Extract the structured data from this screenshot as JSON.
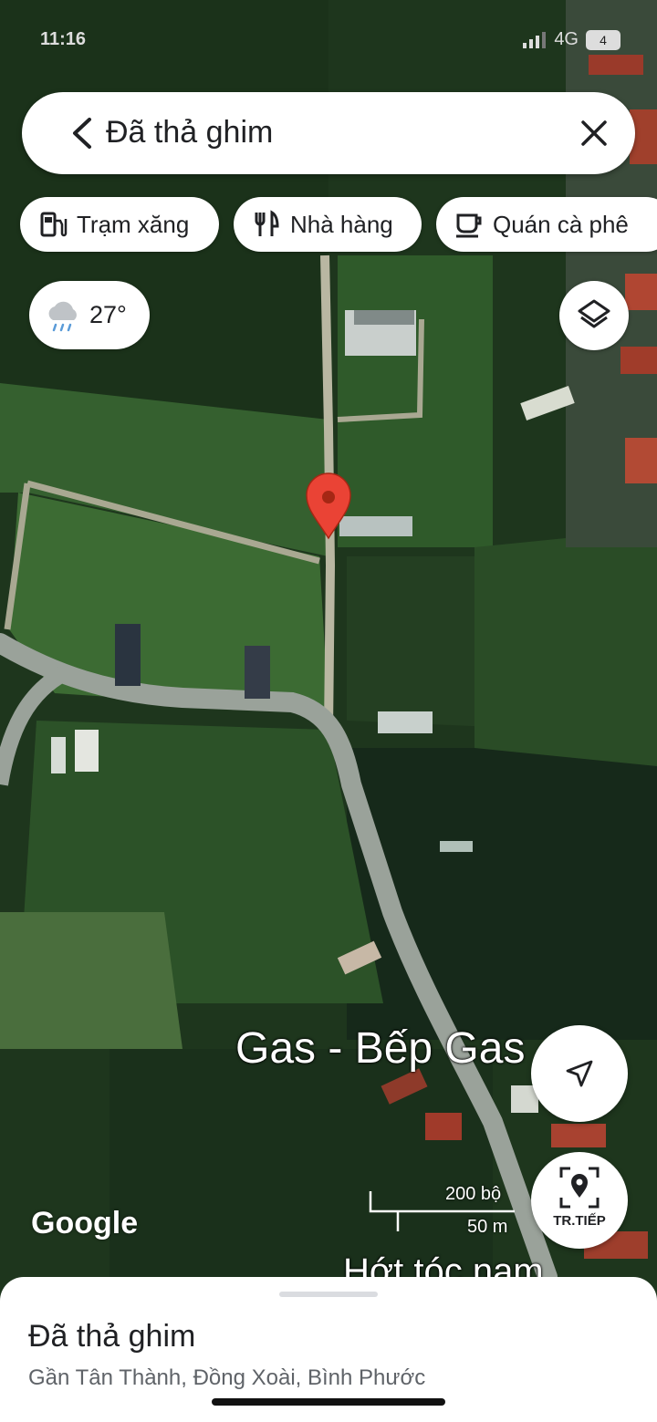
{
  "status_bar": {
    "time": "11:16",
    "network": "4G",
    "battery": "4"
  },
  "search": {
    "title": "Đã thả ghim"
  },
  "chips": [
    {
      "label": "Trạm xăng",
      "icon": "gas-station-icon"
    },
    {
      "label": "Nhà hàng",
      "icon": "restaurant-icon"
    },
    {
      "label": "Quán cà phê",
      "icon": "coffee-icon"
    }
  ],
  "weather": {
    "temp": "27°",
    "icon": "rain-cloud-icon"
  },
  "map_labels": {
    "gas_shop": "Gas - Bếp Gas",
    "hair_salon": "Hớt tóc nam"
  },
  "scale": {
    "imperial": "200 bộ",
    "metric": "50 m"
  },
  "next_button": {
    "label": "TR.TIẾP"
  },
  "attribution": "Google",
  "sheet": {
    "title": "Đã thả ghim",
    "subtitle": "Gần Tân Thành, Đồng Xoài, Bình Phước"
  },
  "colors": {
    "pin": "#ea4335",
    "road": "#9aa29a",
    "forest": "#1f3a1e",
    "field": "#3f6b3a"
  }
}
